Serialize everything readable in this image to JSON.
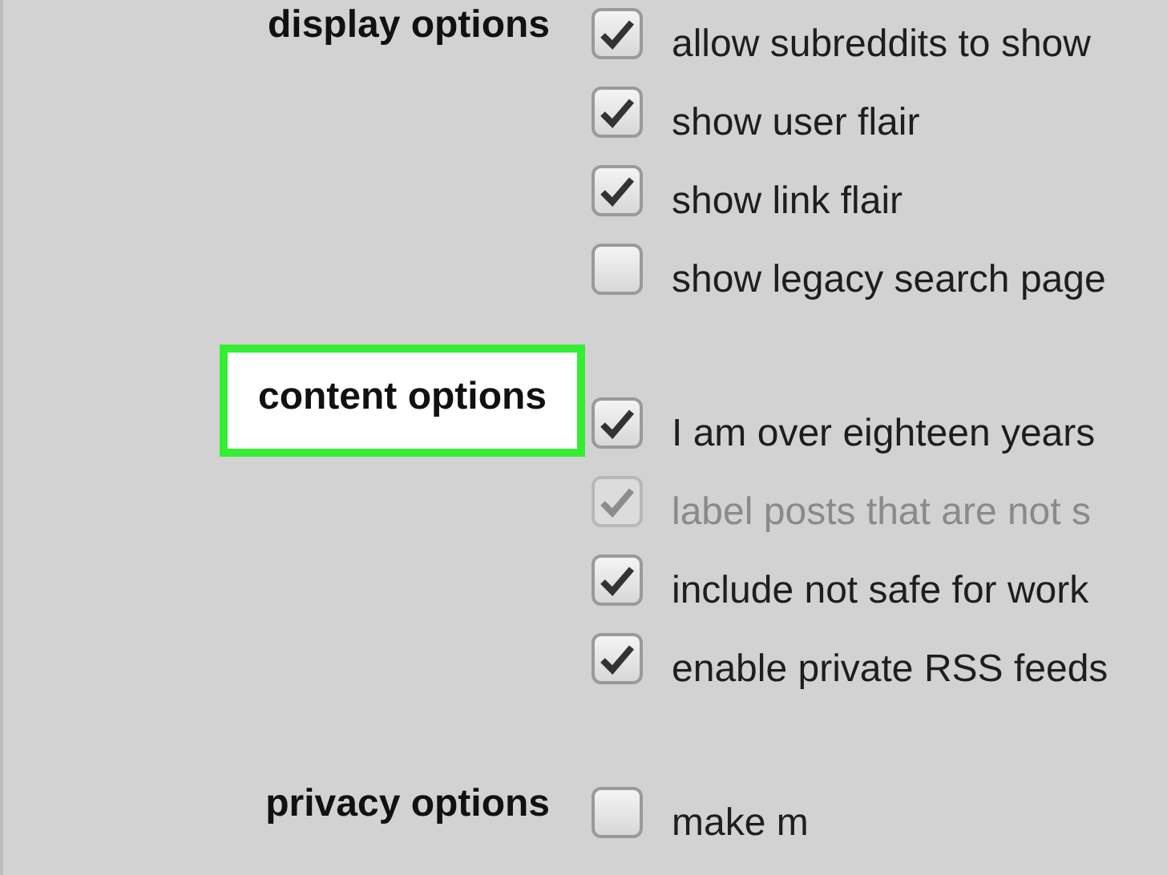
{
  "sections": [
    {
      "label": "display options",
      "highlighted": false,
      "options": [
        {
          "label": "allow subreddits to show",
          "checked": true,
          "disabled": false
        },
        {
          "label": "show user flair",
          "checked": true,
          "disabled": false
        },
        {
          "label": "show link flair",
          "checked": true,
          "disabled": false
        },
        {
          "label": "show legacy search page",
          "checked": false,
          "disabled": false
        }
      ]
    },
    {
      "label": "content options",
      "highlighted": true,
      "options": [
        {
          "label": "I am over eighteen years",
          "checked": true,
          "disabled": false
        },
        {
          "label": "label posts that are not s",
          "checked": true,
          "disabled": true
        },
        {
          "label": "include not safe for work",
          "checked": true,
          "disabled": false
        },
        {
          "label": "enable private RSS feeds",
          "checked": true,
          "disabled": false
        }
      ]
    },
    {
      "label": "privacy options",
      "highlighted": false,
      "options": [
        {
          "label": "make m",
          "checked": false,
          "disabled": false
        }
      ]
    }
  ]
}
